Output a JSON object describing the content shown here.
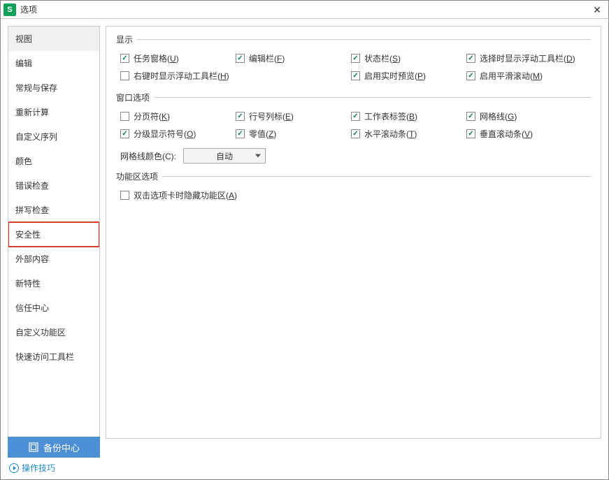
{
  "title": "选项",
  "sidebar": {
    "items": [
      {
        "label": "视图"
      },
      {
        "label": "编辑"
      },
      {
        "label": "常规与保存"
      },
      {
        "label": "重新计算"
      },
      {
        "label": "自定义序列"
      },
      {
        "label": "颜色"
      },
      {
        "label": "错误检查"
      },
      {
        "label": "拼写检查"
      },
      {
        "label": "安全性"
      },
      {
        "label": "外部内容"
      },
      {
        "label": "新特性"
      },
      {
        "label": "信任中心"
      },
      {
        "label": "自定义功能区"
      },
      {
        "label": "快速访问工具栏"
      }
    ]
  },
  "groups": {
    "display": {
      "label": "显示",
      "items": [
        {
          "text": "任务窗格",
          "key": "U",
          "checked": true
        },
        {
          "text": "编辑栏",
          "key": "F",
          "checked": true
        },
        {
          "text": "状态栏",
          "key": "S",
          "checked": true
        },
        {
          "text": "选择时显示浮动工具栏",
          "key": "D",
          "checked": true
        },
        {
          "text": "右键时显示浮动工具栏",
          "key": "H",
          "checked": false
        },
        {
          "text": "",
          "key": "",
          "checked": false,
          "hidden": true
        },
        {
          "text": "启用实时预览",
          "key": "P",
          "checked": true
        },
        {
          "text": "启用平滑滚动",
          "key": "M",
          "checked": true
        }
      ]
    },
    "window": {
      "label": "窗口选项",
      "items": [
        {
          "text": "分页符",
          "key": "K",
          "checked": false
        },
        {
          "text": "行号列标",
          "key": "E",
          "checked": true
        },
        {
          "text": "工作表标签",
          "key": "B",
          "checked": true
        },
        {
          "text": "网格线",
          "key": "G",
          "checked": true
        },
        {
          "text": "分级显示符号",
          "key": "O",
          "checked": true
        },
        {
          "text": "零值",
          "key": "Z",
          "checked": true
        },
        {
          "text": "水平滚动条",
          "key": "T",
          "checked": true
        },
        {
          "text": "垂直滚动条",
          "key": "V",
          "checked": true
        }
      ],
      "gridcolor_label_text": "网格线颜色",
      "gridcolor_label_key": "C",
      "gridcolor_value": "自动"
    },
    "ribbon": {
      "label": "功能区选项",
      "items": [
        {
          "text": "双击选项卡时隐藏功能区",
          "key": "A",
          "checked": false
        }
      ]
    }
  },
  "footer": {
    "backup_label": "备份中心",
    "tips_label": "操作技巧"
  },
  "app_icon_letter": "S"
}
